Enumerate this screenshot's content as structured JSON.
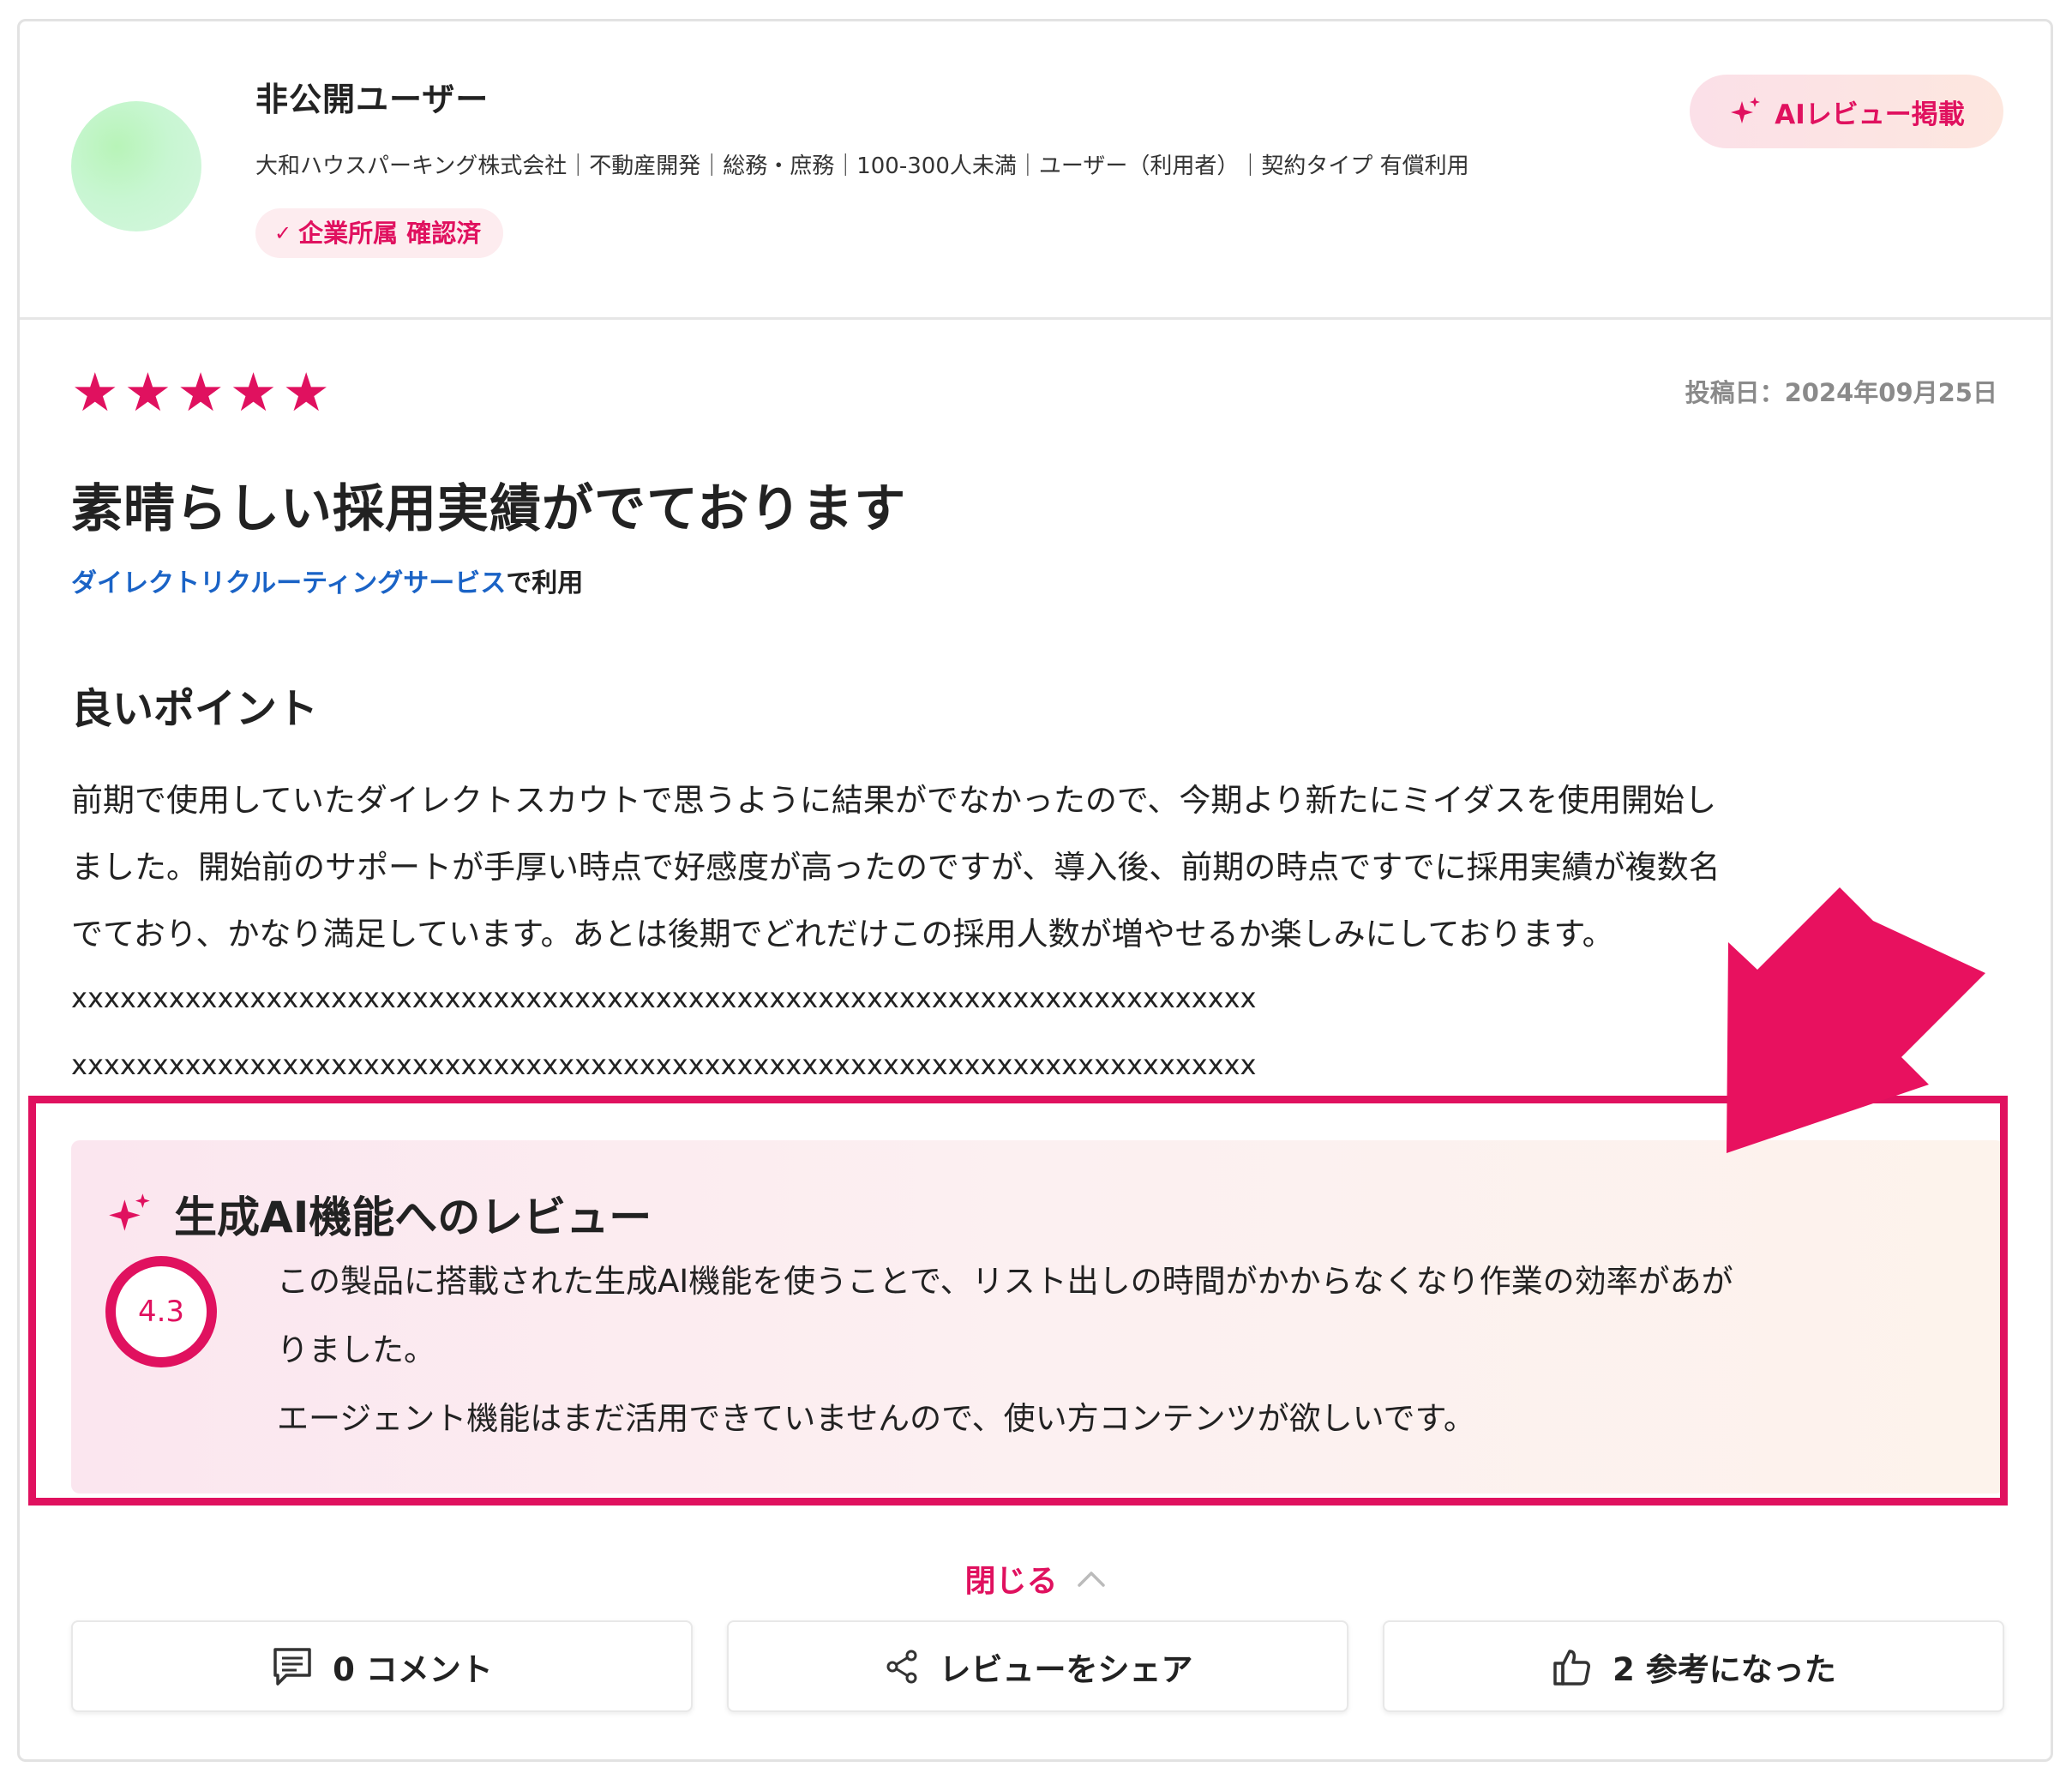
{
  "header": {
    "user_name": "非公開ユーザー",
    "user_meta": "大和ハウスパーキング株式会社｜不動産開発｜総務・庶務｜100-300人未満｜ユーザー（利用者）｜契約タイプ 有償利用",
    "verified_label": "企業所属 確認済",
    "ai_badge_label": "AIレビュー掲載",
    "avatar_color": "#c8f6d2"
  },
  "review": {
    "rating": 5,
    "stars": [
      "★",
      "★",
      "★",
      "★",
      "★"
    ],
    "post_date": "投稿日：2024年09月25日",
    "title": "素晴らしい採用実績がでております",
    "service_link": "ダイレクトリクルーティングサービス",
    "service_suffix": "で利用",
    "section_title": "良いポイント",
    "body_lines": [
      "前期で使用していたダイレクトスカウトで思うように結果がでなかったので、今期より新たにミイダスを使用開始し",
      "ました。開始前のサポートが手厚い時点で好感度が高ったのですが、導入後、前期の時点ですでに採用実績が複数名",
      "でており、かなり満足しています。あとは後期でどれだけこの採用人数が増やせるか楽しみにしております。"
    ],
    "masked_lines": [
      "xxxxxxxxxxxxxxxxxxxxxxxxxxxxxxxxxxxxxxxxxxxxxxxxxxxxxxxxxxxxxxxxxxxxxxxxx",
      "xxxxxxxxxxxxxxxxxxxxxxxxxxxxxxxxxxxxxxxxxxxxxxxxxxxxxxxxxxxxxxxxxxxxxxxxx"
    ]
  },
  "ai_review": {
    "title": "生成AI機能へのレビュー",
    "score": "4.3",
    "text_lines": [
      "この製品に搭載された生成AI機能を使うことで、リスト出しの時間がかからなくなり作業の効率があが",
      "りました。",
      "エージェント機能はまだ活用できていませんので、使い方コンテンツが欲しいです。"
    ]
  },
  "toggle": {
    "close_label": "閉じる"
  },
  "actions": {
    "comment_label": "0 コメント",
    "share_label": "レビューをシェア",
    "helpful_label": "2 参考になった"
  },
  "colors": {
    "accent": "#e0115f",
    "link": "#1a63c6"
  }
}
